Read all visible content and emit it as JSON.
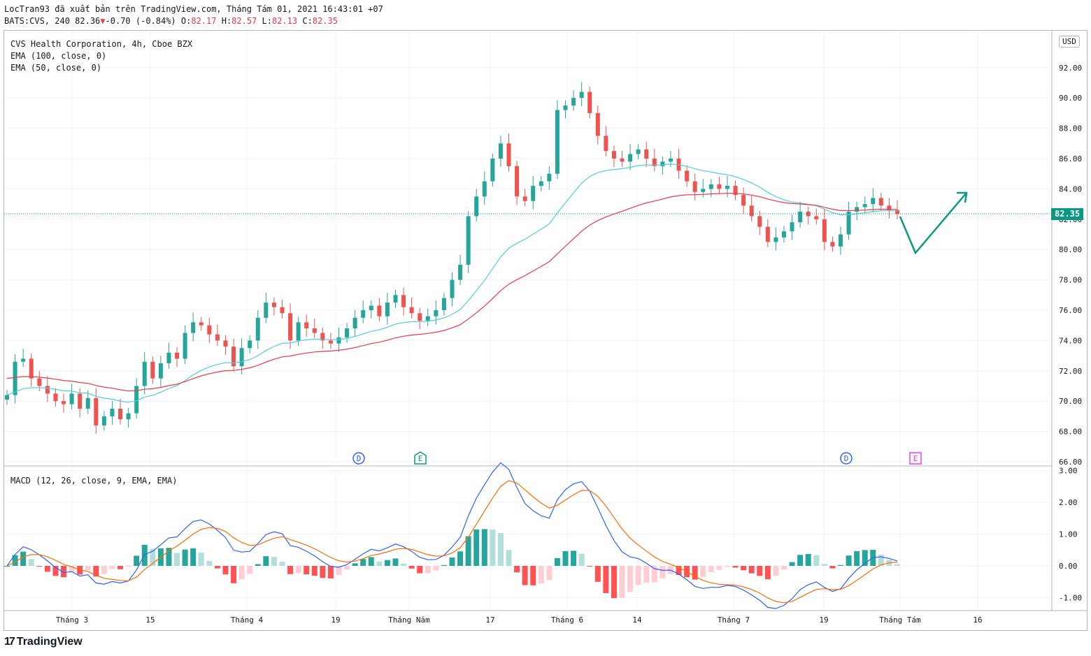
{
  "header": {
    "line1": "LocTran93 đã xuất bản trên TradingView.com, Tháng Tám 01, 2021 16:43:01 +07",
    "symbol": "BATS:CVS, 240",
    "last": "82.36",
    "change_arrow": "▼",
    "change": "-0.70 (-0.84%)",
    "o_label": "O:",
    "o_val": "82.17",
    "h_label": "H:",
    "h_val": "82.57",
    "l_label": "L:",
    "l_val": "82.13",
    "c_label": "C:",
    "c_val": "82.35"
  },
  "legend": {
    "title": "CVS Health Corporation, 4h, Cboe BZX",
    "ema100": "EMA (100, close, 0)",
    "ema50": "EMA (50, close, 0)",
    "macd": "MACD (12, 26, close, 9, EMA, EMA)"
  },
  "currency_label": "USD",
  "last_price_tag": "82.35",
  "price_axis": [
    "92.00",
    "90.00",
    "88.00",
    "86.00",
    "84.00",
    "82.00",
    "80.00",
    "78.00",
    "76.00",
    "74.00",
    "72.00",
    "70.00",
    "68.00",
    "66.00"
  ],
  "macd_axis": [
    "3.00",
    "2.00",
    "1.00",
    "0.00",
    "-1.00"
  ],
  "time_axis": [
    "Tháng 3",
    "15",
    "Tháng 4",
    "19",
    "Tháng Năm",
    "17",
    "Tháng 6",
    "14",
    "Tháng 7",
    "19",
    "Tháng Tám",
    "16"
  ],
  "event_markers": [
    {
      "label": "D",
      "color": "#2962ff",
      "shape": "circle"
    },
    {
      "label": "E",
      "color": "#089981",
      "shape": "pentagon"
    },
    {
      "label": "D",
      "color": "#2962ff",
      "shape": "circle"
    },
    {
      "label": "E",
      "color": "#e040fb",
      "shape": "square"
    }
  ],
  "colors": {
    "up": "#26a69a",
    "down": "#ef5350",
    "ema50": "#4dd0e1",
    "ema100": "#f23645",
    "macd_line": "#2962ff",
    "signal_line": "#ff6d00",
    "arrow": "#089981"
  },
  "footer": {
    "brand": "TradingView",
    "mark": "17"
  },
  "chart_data": {
    "type": "candlestick",
    "title": "CVS Health Corporation, 4h, Cboe BZX",
    "ylim": [
      66,
      93
    ],
    "closes": [
      70.4,
      72.6,
      72.8,
      71.5,
      71.0,
      70.5,
      70.0,
      69.8,
      70.5,
      69.5,
      70.2,
      68.4,
      69.0,
      69.5,
      68.8,
      69.2,
      71.0,
      72.6,
      71.5,
      72.5,
      73.2,
      72.8,
      74.5,
      75.2,
      75.0,
      74.4,
      74.0,
      73.6,
      72.3,
      73.5,
      74.0,
      75.5,
      76.5,
      76.2,
      75.8,
      74.0,
      75.2,
      74.8,
      74.5,
      74.0,
      73.8,
      74.2,
      74.8,
      75.5,
      76.0,
      76.3,
      75.6,
      76.5,
      77.0,
      76.2,
      75.8,
      75.3,
      75.6,
      76.0,
      76.8,
      78.0,
      79.0,
      82.2,
      83.5,
      84.5,
      86.0,
      87.0,
      85.5,
      83.5,
      83.2,
      84.2,
      84.5,
      85.0,
      89.2,
      89.5,
      90.0,
      90.4,
      89.0,
      87.5,
      86.5,
      86.0,
      85.8,
      86.3,
      86.6,
      86.0,
      85.5,
      85.8,
      86.0,
      85.2,
      84.5,
      83.8,
      84.0,
      84.3,
      84.0,
      84.2,
      83.6,
      82.9,
      82.2,
      81.5,
      80.5,
      80.8,
      81.2,
      81.8,
      82.5,
      82.2,
      82.0,
      80.5,
      80.2,
      81.0,
      82.5,
      82.8,
      83.0,
      83.4,
      82.9,
      82.6,
      82.35
    ]
  }
}
